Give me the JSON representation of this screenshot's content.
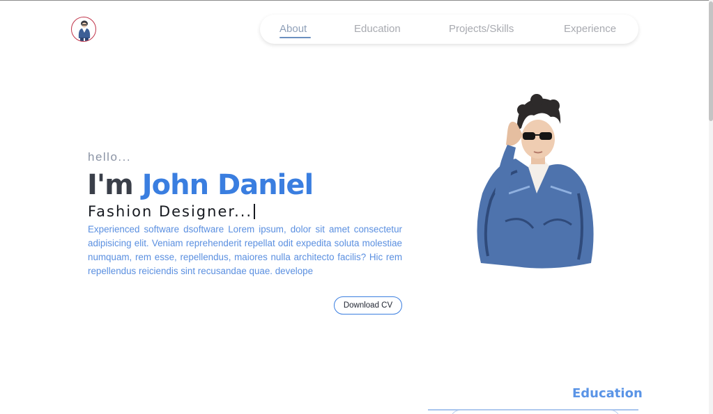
{
  "nav": {
    "items": [
      {
        "label": "About",
        "active": true
      },
      {
        "label": "Education",
        "active": false
      },
      {
        "label": "Projects/Skills",
        "active": false
      },
      {
        "label": "Experience",
        "active": false
      }
    ]
  },
  "hero": {
    "greeting": "hello...",
    "intro": "I'm",
    "name": "John Daniel",
    "role": "Fashion Designer...",
    "bio": "Experienced software dsoftware Lorem ipsum, dolor sit amet consectetur adipisicing elit. Veniam reprehenderit repellat odit expedita soluta molestiae numquam, rem esse, repellendus, maiores nulla architecto facilis? Hic rem repellendus reiciendis sint recusandae quae. develope",
    "cv_button": "Download CV"
  },
  "education": {
    "title": "Education"
  },
  "colors": {
    "accent": "#3a7ee0",
    "text_dark": "#3a3f49",
    "bio_text": "#5a8fe0"
  },
  "icons": {
    "logo": "avatar-logo-icon",
    "portrait": "portrait-illustration"
  }
}
